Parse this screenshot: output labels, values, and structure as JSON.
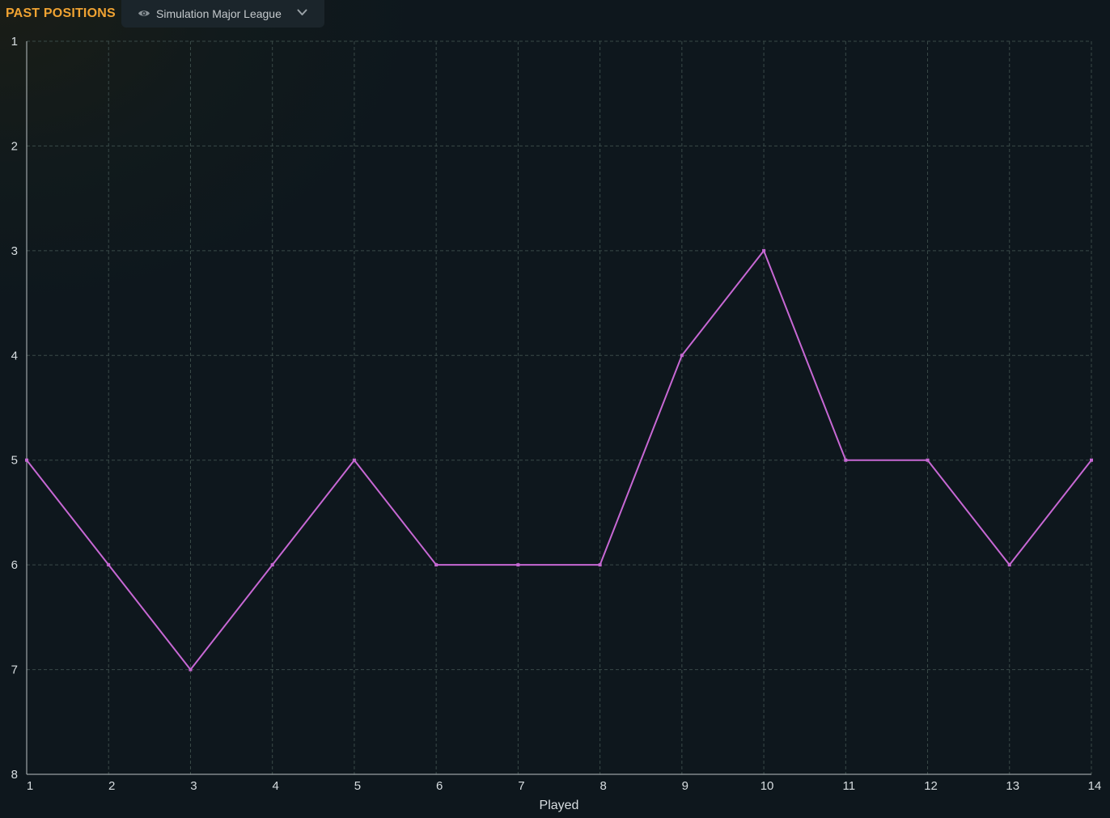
{
  "header": {
    "title": "PAST POSITIONS",
    "league_select": {
      "value": "Simulation Major League",
      "icon": "eye-icon",
      "dropdown_icon": "chevron-down-icon"
    }
  },
  "colors": {
    "title": "#f0a332",
    "line": "#c768d4",
    "background": "#0e171d",
    "grid": "#3a4a48"
  },
  "chart_data": {
    "type": "line",
    "xlabel": "Played",
    "ylabel": "",
    "x": [
      1,
      2,
      3,
      4,
      5,
      6,
      7,
      8,
      9,
      10,
      11,
      12,
      13,
      14
    ],
    "series": [
      {
        "values": [
          5,
          6,
          7,
          6,
          5,
          6,
          6,
          6,
          4,
          3,
          5,
          5,
          6,
          5
        ]
      }
    ],
    "xlim": [
      1,
      14
    ],
    "ylim": [
      1,
      8
    ],
    "y_inverted": true,
    "xticks": [
      1,
      2,
      3,
      4,
      5,
      6,
      7,
      8,
      9,
      10,
      11,
      12,
      13,
      14
    ],
    "yticks": [
      1,
      2,
      3,
      4,
      5,
      6,
      7,
      8
    ],
    "grid": true,
    "grid_style": "dashed",
    "legend": "none"
  }
}
